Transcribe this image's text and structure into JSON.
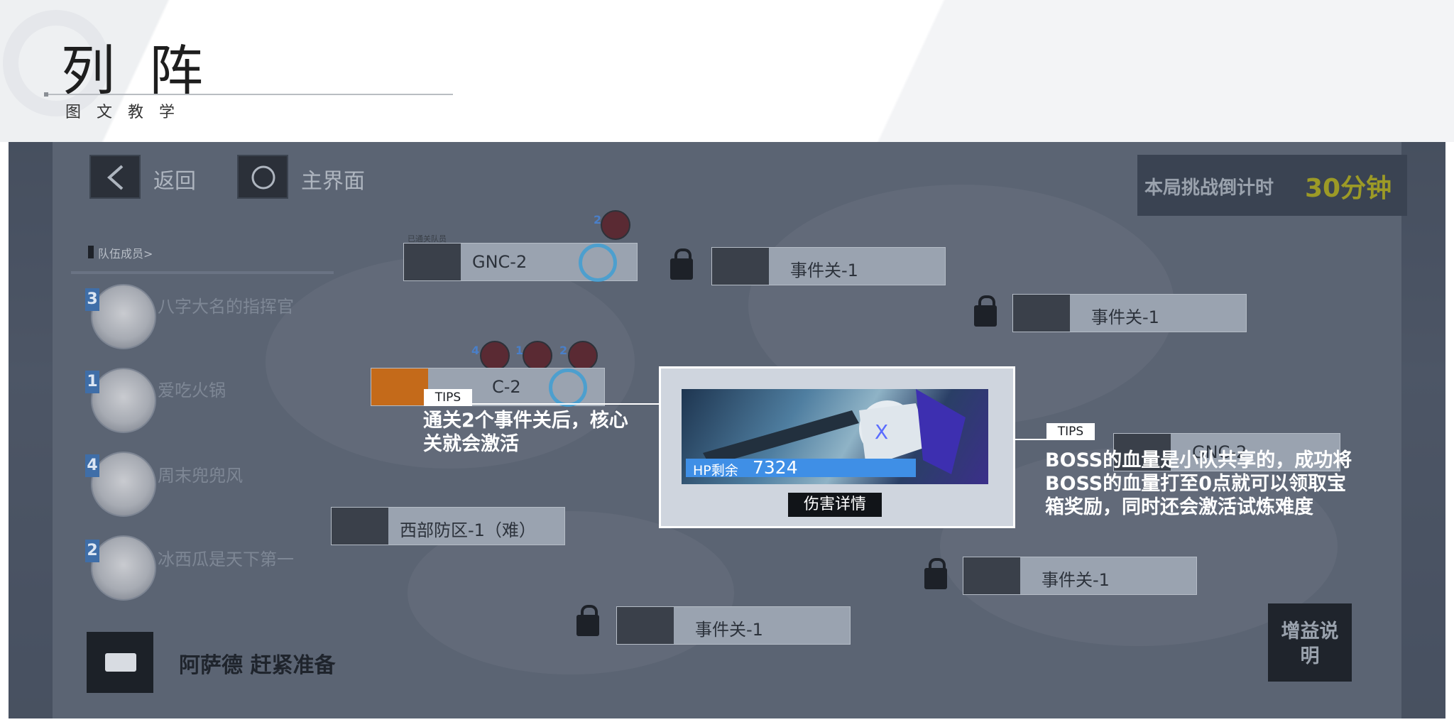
{
  "header": {
    "title": "列阵",
    "subtitle": "图文教学"
  },
  "game": {
    "back_label": "返回",
    "home_label": "主界面",
    "countdown_label": "本局挑战倒计时",
    "countdown_value": "30分钟",
    "team_header": "队伍成员>",
    "members": [
      {
        "number": "3",
        "name": "八字大名的指挥官"
      },
      {
        "number": "1",
        "name": "爱吃火锅"
      },
      {
        "number": "4",
        "name": "周末兜兜风"
      },
      {
        "number": "2",
        "name": "冰西瓜是天下第一"
      }
    ],
    "stage_caption": "已通关队员",
    "stages": {
      "gnc2_top": "GNC-2",
      "event_top": "事件关-1",
      "event_right": "事件关-1",
      "gnc2_mid": "C-2",
      "gnc2_right": "GNC-2",
      "west": "西部防区-1（难）",
      "event_bottom_mid": "事件关-1",
      "event_bottom_right": "事件关-1"
    },
    "marker_numbers": {
      "top": "2",
      "mid_a": "4",
      "mid_b": "1",
      "mid_c": "2"
    },
    "boss": {
      "hp_label": "HP剩余",
      "hp_value": "7324",
      "damage_button": "伤害详情"
    },
    "chat_text": "阿萨德 赶紧准备",
    "buff_button": "增益说明"
  },
  "tips": [
    {
      "tag": "TIPS",
      "text": "通关2个事件关后，核心关就会激活"
    },
    {
      "tag": "TIPS",
      "text": "BOSS的血量是小队共享的，成功将BOSS的血量打至0点就可以领取宝箱奖励，同时还会激活试炼难度"
    }
  ],
  "colors": {
    "accent_blue": "#3f8fe6",
    "countdown_yellow": "#9c9a26",
    "check_blue": "#3a9ed6"
  }
}
